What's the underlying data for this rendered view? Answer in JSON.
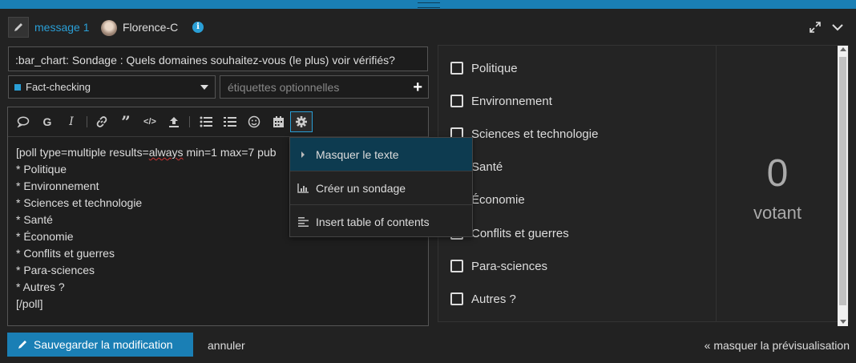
{
  "header": {
    "message_link": "message 1",
    "username": "Florence-C",
    "info_symbol": "i"
  },
  "composer": {
    "title_value": ":bar_chart: Sondage : Quels domaines souhaitez-vous (le plus) voir vérifiés?",
    "category": {
      "label": "Fact-checking",
      "color": "#2a9fd6"
    },
    "tags_placeholder": "étiquettes optionnelles",
    "tags_add": "+"
  },
  "toolbar": {
    "icons": [
      "quote-icon",
      "bold-icon",
      "italic-icon",
      "link-icon",
      "blockquote-icon",
      "code-icon",
      "upload-icon",
      "bullet-list-icon",
      "numbered-list-icon",
      "emoji-icon",
      "calendar-icon",
      "gear-icon"
    ],
    "bold": "G",
    "italic": "I"
  },
  "editor": {
    "line1_a": "[poll type=multiple results=",
    "line1_b": "always",
    "line1_c": " min=1 max=7 pub",
    "lines": [
      "* Politique",
      "* Environnement",
      "* Sciences et technologie",
      "* Santé",
      "* Économie",
      "* Conflits et guerres",
      "* Para-sciences",
      "* Autres ?",
      "[/poll]"
    ]
  },
  "menu": {
    "items": [
      {
        "label": "Masquer le texte",
        "icon": "caret-right-icon",
        "selected": true
      },
      {
        "label": "Créer un sondage",
        "icon": "bar-chart-icon",
        "selected": false
      },
      {
        "label": "Insert table of contents",
        "icon": "align-left-icon",
        "selected": false
      }
    ]
  },
  "preview": {
    "options": [
      "Politique",
      "Environnement",
      "Sciences et technologie",
      "Santé",
      "Économie",
      "Conflits et guerres",
      "Para-sciences",
      "Autres ?"
    ],
    "voter_count": "0",
    "voter_label": "votant"
  },
  "footer": {
    "save_label": "Sauvegarder la modification",
    "cancel_label": "annuler",
    "hide_preview_label": "« masquer la prévisualisation"
  },
  "colors": {
    "accent": "#1a7fb5",
    "link": "#2a9fd6",
    "background": "#222222"
  }
}
